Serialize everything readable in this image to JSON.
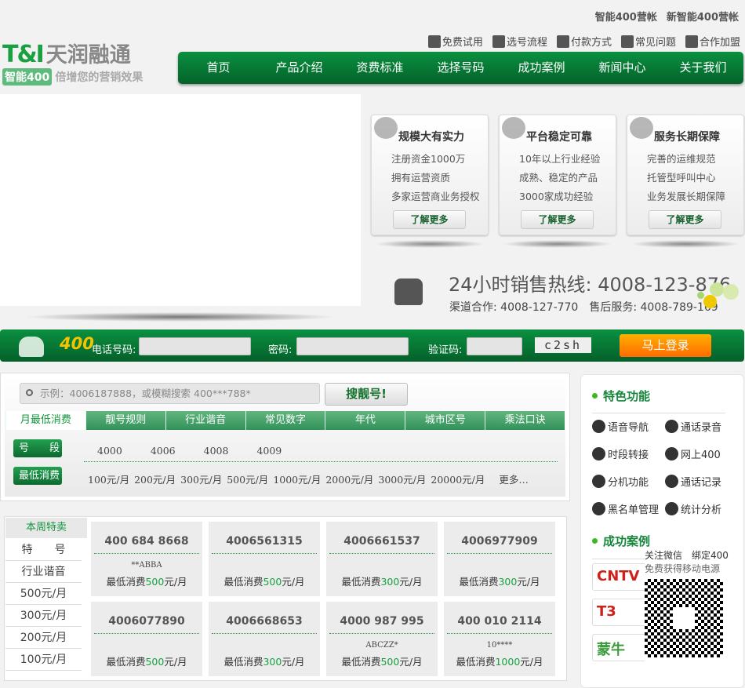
{
  "top": {
    "accounts": [
      "智能400营帐",
      "新智能400营帐"
    ]
  },
  "logo": {
    "mark": "T&I",
    "name": "天润融通",
    "badge": "智能400",
    "slogan": "倍增您的营销效果"
  },
  "links": [
    {
      "icon": "pencil-icon",
      "label": "免费试用"
    },
    {
      "icon": "book-icon",
      "label": "选号流程"
    },
    {
      "icon": "grid-icon",
      "label": "付款方式"
    },
    {
      "icon": "chat-icon",
      "label": "常见问题"
    },
    {
      "icon": "user-icon",
      "label": "合作加盟"
    }
  ],
  "nav": [
    "首页",
    "产品介绍",
    "资费标准",
    "选择号码",
    "成功案例",
    "新闻中心",
    "关于我们"
  ],
  "cards": [
    {
      "icon": "globe-icon",
      "title": "规模大有实力",
      "lines": [
        "注册资金1000万",
        "拥有运营资质",
        "多家运营商业务授权"
      ],
      "more": "了解更多"
    },
    {
      "icon": "document-icon",
      "title": "平台稳定可靠",
      "lines": [
        "10年以上行业经验",
        "成熟、稳定的产品",
        "3000家成功经验"
      ],
      "more": "了解更多"
    },
    {
      "icon": "person-card-icon",
      "title": "服务长期保障",
      "lines": [
        "完善的运维规范",
        "托管型呼叫中心",
        "业务发展长期保障"
      ],
      "more": "了解更多"
    }
  ],
  "hotline": {
    "main": "24小时销售热线: 4008-123-876",
    "sub": "渠道合作: 4008-127-770　售后服务: 4008-789-169"
  },
  "login": {
    "brand": "400",
    "phone_label": "电话号码:",
    "password_label": "密码:",
    "captcha_label": "验证码:",
    "captcha": "c2sh",
    "submit": "马上登录",
    "colors": {
      "bar": "#05782f",
      "button": "#ff8a00"
    }
  },
  "search": {
    "placeholder": "示例：4006187888，或模糊搜索 400***788*",
    "button": "搜靓号!",
    "tabs": [
      "月最低消费",
      "靓号规则",
      "行业谐音",
      "常见数字",
      "年代",
      "城市区号",
      "乘法口诀"
    ],
    "segment_label": "号　　段",
    "segments": [
      "4000",
      "4006",
      "4008",
      "4009"
    ],
    "min_label": "最低消费",
    "mins": [
      "100元/月",
      "200元/月",
      "300元/月",
      "500元/月",
      "1000元/月",
      "2000元/月",
      "3000元/月",
      "20000元/月"
    ],
    "more": "更多…"
  },
  "side": {
    "features_title": "特色功能",
    "features": [
      {
        "icon": "clock-icon",
        "label": "语音导航"
      },
      {
        "icon": "record-icon",
        "label": "通话录音"
      },
      {
        "icon": "award-icon",
        "label": "时段转接"
      },
      {
        "icon": "web-icon",
        "label": "网上400"
      },
      {
        "icon": "cloud-icon",
        "label": "分机功能"
      },
      {
        "icon": "check-icon",
        "label": "通话记录"
      },
      {
        "icon": "map-icon",
        "label": "黑名单管理"
      },
      {
        "icon": "share-icon",
        "label": "统计分析"
      }
    ],
    "cases_title": "成功案例",
    "cases": [
      "CNTV",
      "T3",
      "蒙牛"
    ],
    "qr": {
      "line1": "关注微信　绑定400",
      "line2": "免费获得移动电源"
    }
  },
  "specials": {
    "tab": "本周特卖",
    "filters": [
      "特　　号",
      "行业谐音",
      "500元/月",
      "300元/月",
      "200元/月",
      "100元/月"
    ],
    "price_prefix": "最低消费",
    "price_suffix": "元/月",
    "items": [
      {
        "number": "400 684 8668",
        "pattern": "**ABBA",
        "price": "500"
      },
      {
        "number": "4006561315",
        "pattern": "",
        "price": "500"
      },
      {
        "number": "4006661537",
        "pattern": "",
        "price": "300"
      },
      {
        "number": "4006977909",
        "pattern": "",
        "price": "300"
      },
      {
        "number": "4006077890",
        "pattern": "",
        "price": "500"
      },
      {
        "number": "4006668653",
        "pattern": "",
        "price": "300"
      },
      {
        "number": "4000 987 995",
        "pattern": "ABCZZ*",
        "price": "500"
      },
      {
        "number": "400 010 2114",
        "pattern": "10****",
        "price": "1000"
      }
    ]
  }
}
